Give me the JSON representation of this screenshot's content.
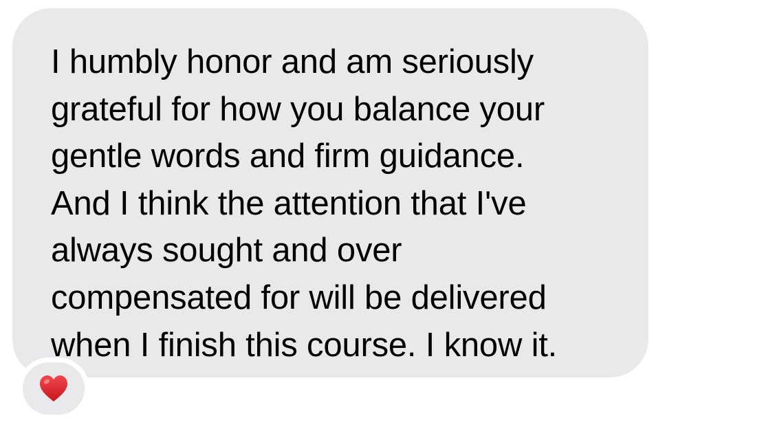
{
  "message": {
    "lines": [
      "I humbly honor and am seriously",
      "grateful for how you balance your",
      "gentle words and firm guidance.",
      "And I think the attention that I've",
      "always sought and over",
      "compensated for will be delivered",
      "when I finish this course. I know it."
    ],
    "bubble_color": "#e9e9eb",
    "text_color": "#000000"
  },
  "reaction": {
    "icon": "heart-icon",
    "color": "#e3242b"
  }
}
